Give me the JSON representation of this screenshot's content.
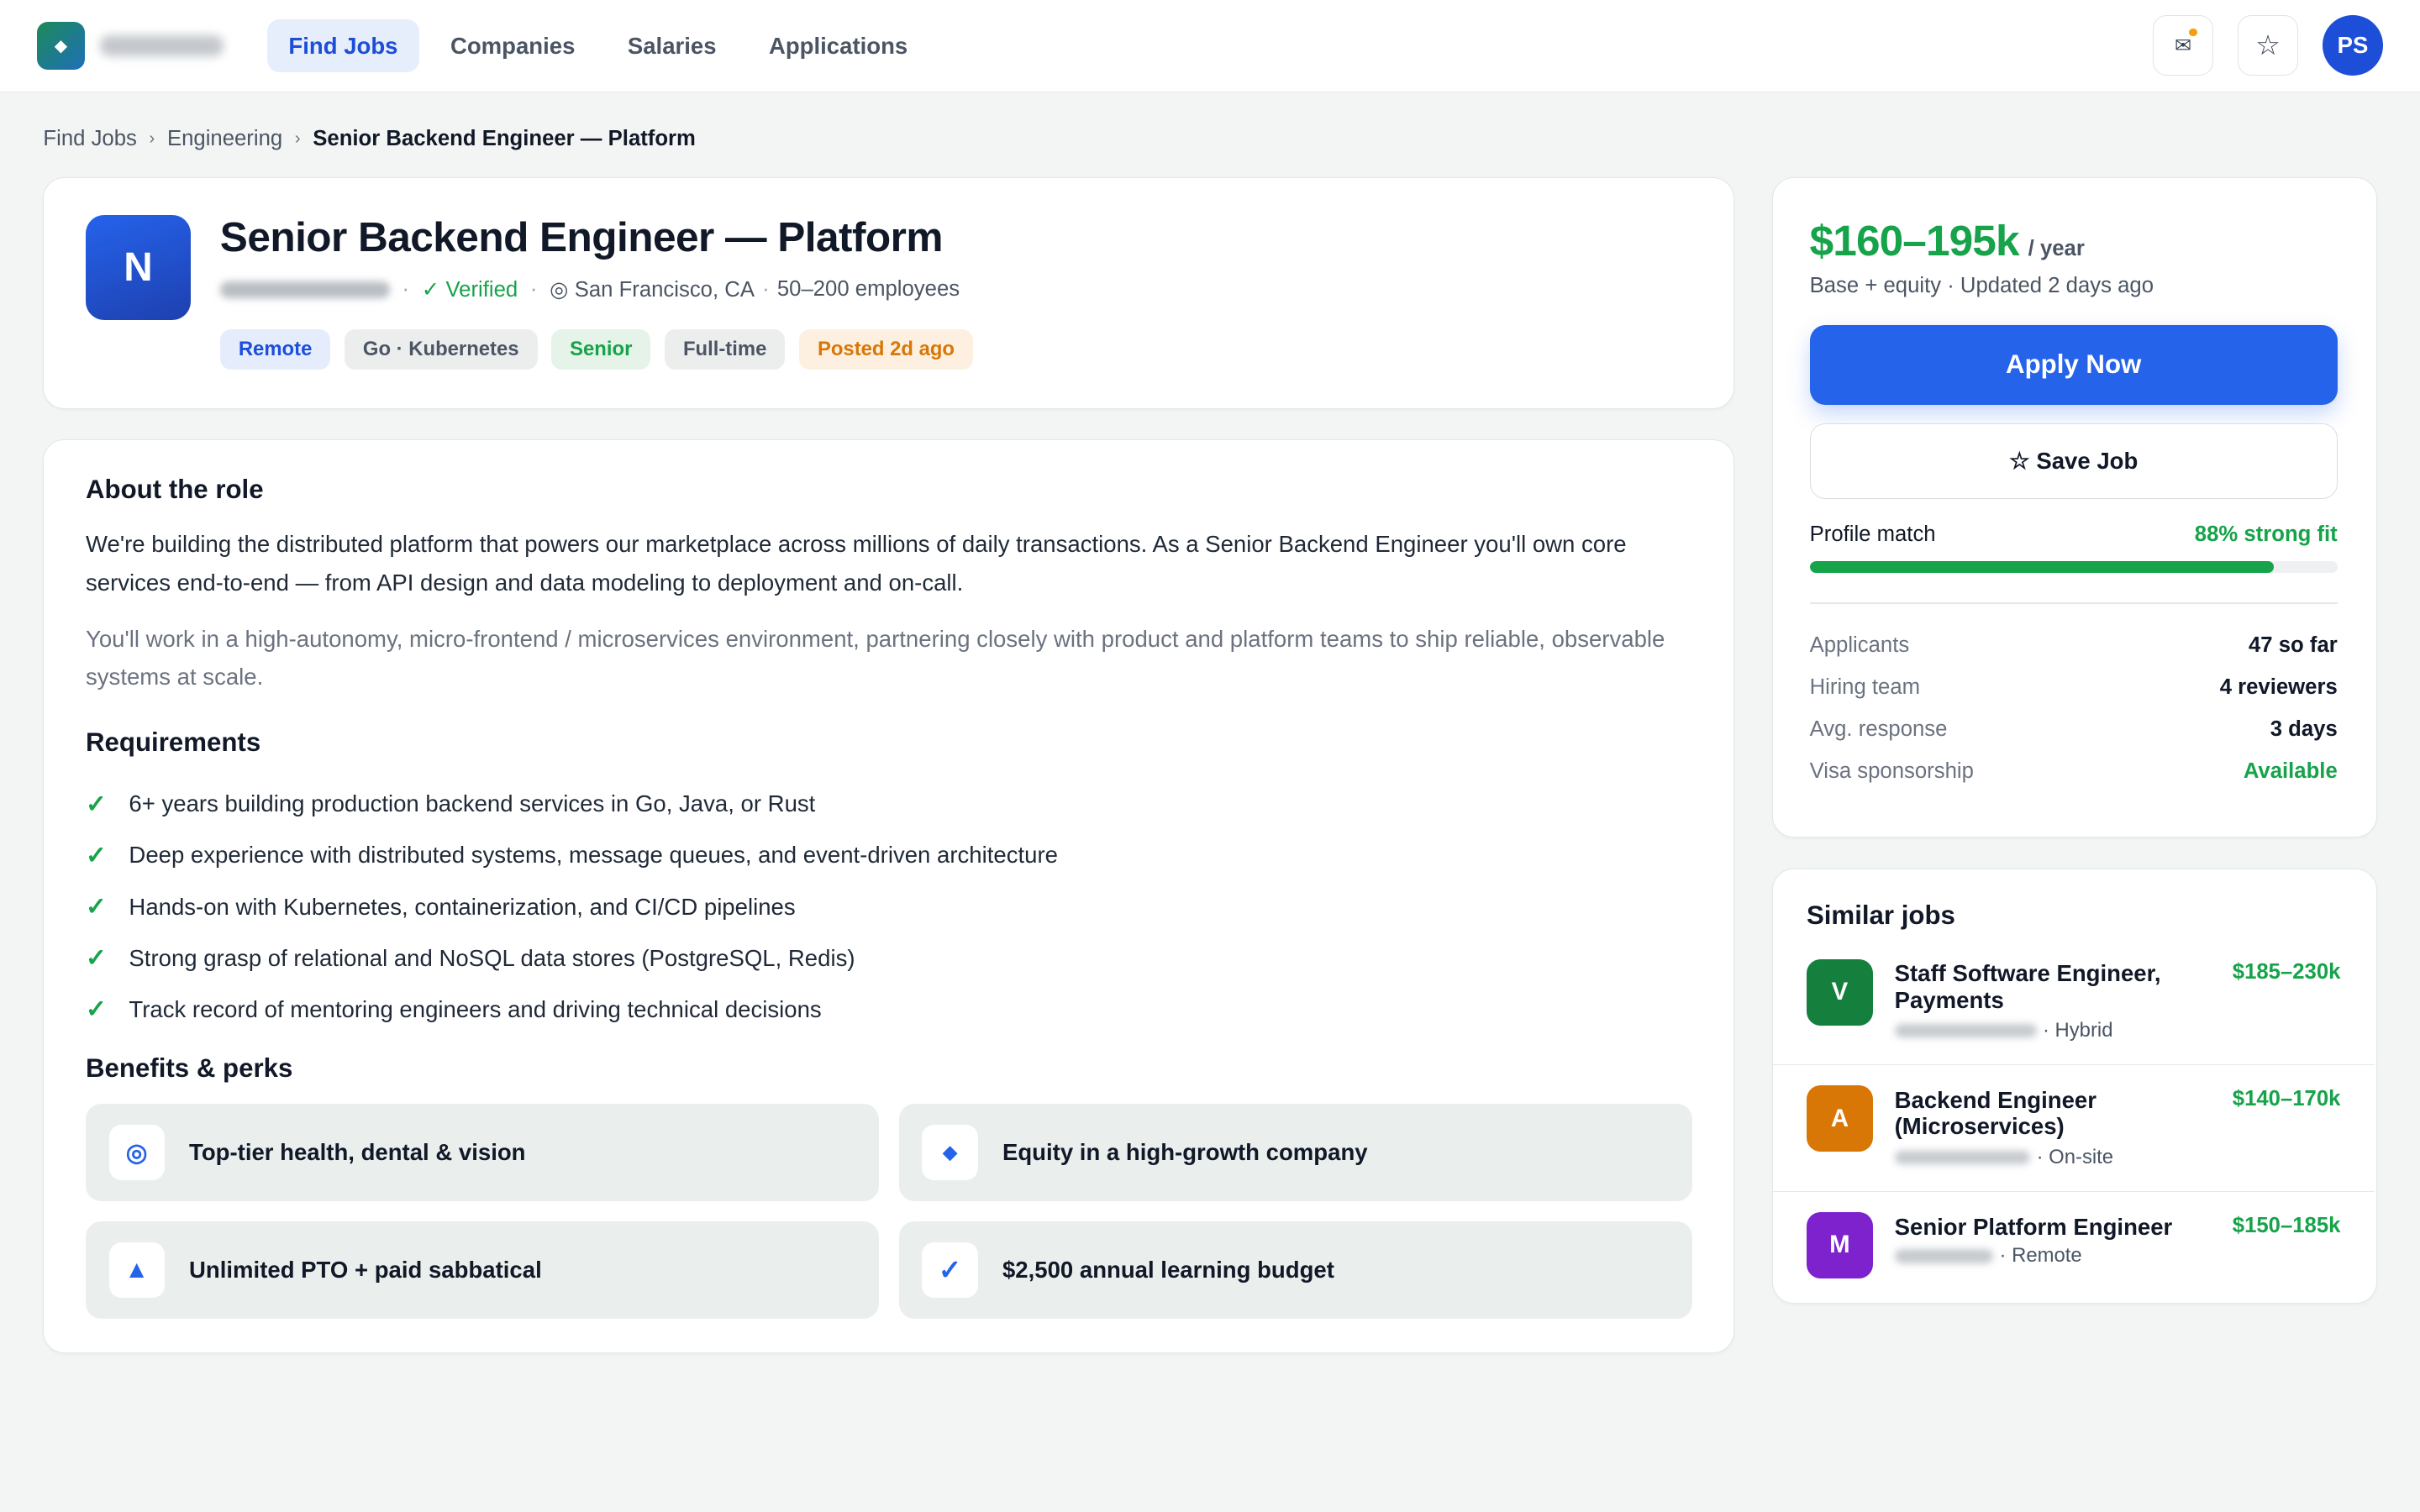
{
  "app": {
    "logo_icon": "diamond-icon"
  },
  "nav": {
    "find_jobs": "Find Jobs",
    "companies": "Companies",
    "salaries": "Salaries",
    "applications": "Applications"
  },
  "top_actions": {
    "messages_icon": "✉",
    "star_icon": "☆",
    "avatar_initials": "PS"
  },
  "breadcrumb": {
    "level1": "Find Jobs",
    "level2": "Engineering",
    "current": "Senior Backend Engineer — Platform",
    "separator": "›"
  },
  "job": {
    "logo_letter": "N",
    "title": "Senior Backend Engineer — Platform",
    "verified": "✓ Verified",
    "location": "◎ San Francisco, CA",
    "size": "50–200 employees",
    "chips": [
      "Remote",
      "Go · Kubernetes",
      "Senior",
      "Full-time",
      "Posted 2d ago"
    ]
  },
  "details": {
    "about_heading": "About the role",
    "about_p1": "We're building the distributed platform that powers our marketplace across millions of daily transactions. As a Senior Backend Engineer you'll own core services end-to-end — from API design and data modeling to deployment and on-call.",
    "about_p2": "You'll work in a high-autonomy, micro-frontend / microservices environment, partnering closely with product and platform teams to ship reliable, observable systems at scale.",
    "requirements_heading": "Requirements",
    "requirements": [
      "6+ years building production backend services in Go, Java, or Rust",
      "Deep experience with distributed systems, message queues, and event-driven architecture",
      "Hands-on with Kubernetes, containerization, and CI/CD pipelines",
      "Strong grasp of relational and NoSQL data stores (PostgreSQL, Redis)",
      "Track record of mentoring engineers and driving technical decisions"
    ],
    "check_glyph": "✓",
    "benefits_heading": "Benefits & perks",
    "perks": [
      {
        "icon": "◎",
        "label": "Top-tier health, dental & vision"
      },
      {
        "icon": "◆",
        "label": "Equity in a high-growth company"
      },
      {
        "icon": "▲",
        "label": "Unlimited PTO + paid sabbatical"
      },
      {
        "icon": "✓",
        "label": "$2,500 annual learning budget"
      }
    ]
  },
  "salary": {
    "amount": "$160–195k",
    "unit": "/ year",
    "subtitle": "Base + equity · Updated 2 days ago",
    "apply_label": "Apply Now",
    "save_label": "☆ Save Job",
    "match_label": "Profile match",
    "match_value": "88% strong fit",
    "match_fraction": 0.88,
    "stats": [
      {
        "label": "Applicants",
        "value": "47 so far"
      },
      {
        "label": "Hiring team",
        "value": "4 reviewers"
      },
      {
        "label": "Avg. response",
        "value": "3 days"
      },
      {
        "label": "Visa sponsorship",
        "value": "Available"
      }
    ]
  },
  "similar": {
    "heading": "Similar jobs",
    "items": [
      {
        "letter": "V",
        "color": "#15803d",
        "title": "Staff Software Engineer, Payments",
        "mode": "· Hybrid",
        "salary": "$185–230k"
      },
      {
        "letter": "A",
        "color": "#d97706",
        "title": "Backend Engineer (Microservices)",
        "mode": "· On-site",
        "salary": "$140–170k"
      },
      {
        "letter": "M",
        "color": "#7e22ce",
        "title": "Senior Platform Engineer",
        "mode": "· Remote",
        "salary": "$150–185k"
      }
    ]
  },
  "colors": {
    "accent": "#2563eb",
    "success": "#16a34a",
    "warning": "#d97706"
  }
}
